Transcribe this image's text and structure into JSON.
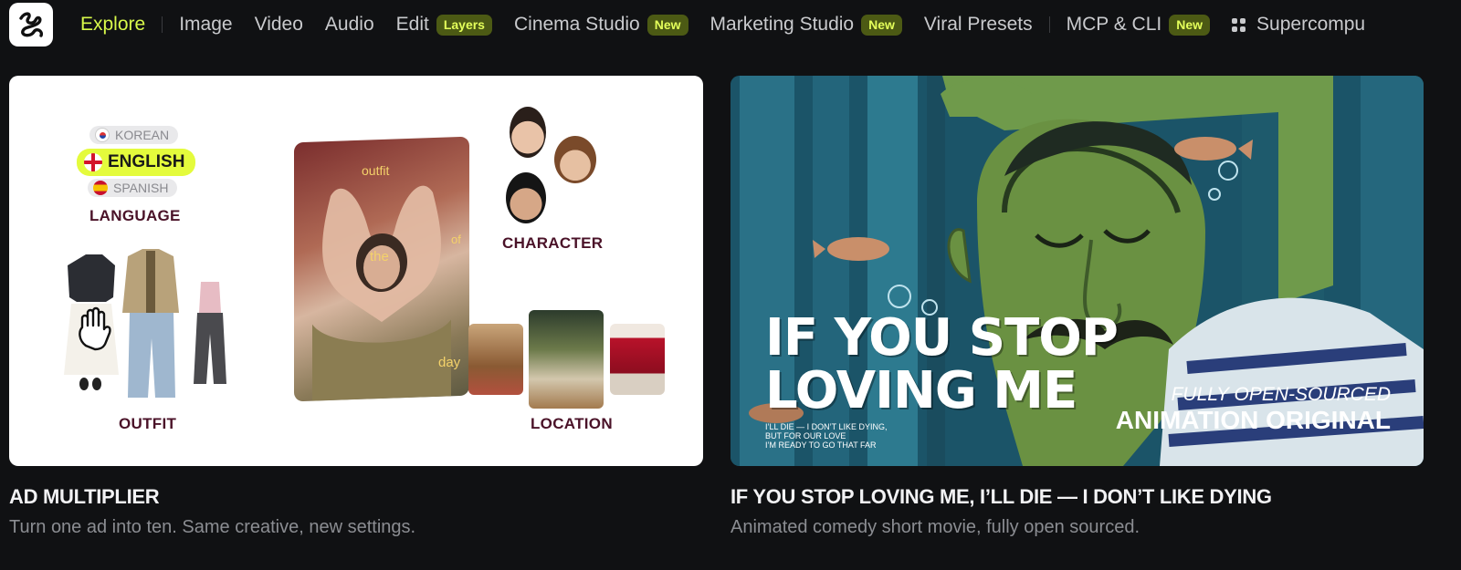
{
  "nav": {
    "items": [
      {
        "label": "Explore",
        "active": true
      },
      {
        "label": "Image"
      },
      {
        "label": "Video"
      },
      {
        "label": "Audio"
      },
      {
        "label": "Edit",
        "badge": "Layers"
      },
      {
        "label": "Cinema Studio",
        "badge": "New"
      },
      {
        "label": "Marketing Studio",
        "badge": "New"
      },
      {
        "label": "Viral Presets"
      },
      {
        "label": "MCP & CLI",
        "badge": "New"
      },
      {
        "label": "Supercompu"
      }
    ]
  },
  "cards": [
    {
      "title": "AD MULTIPLIER",
      "subtitle": "Turn one ad into ten. Same creative, new settings.",
      "image": {
        "languages": [
          "KOREAN",
          "ENGLISH",
          "SPANISH"
        ],
        "language_label": "LANGUAGE",
        "character_label": "CHARACTER",
        "outfit_label": "OUTFIT",
        "location_label": "LOCATION",
        "overlay_words": [
          "outfit",
          "of",
          "the",
          "day"
        ]
      }
    },
    {
      "title": "IF YOU STOP LOVING ME, I’LL DIE — I DON’T LIKE DYING",
      "subtitle": "Animated comedy short movie, fully open sourced.",
      "image": {
        "poster_line1": "IF YOU STOP",
        "poster_line2": "LOVING ME",
        "tagline_lines": [
          "I’LL DIE — I DON’T LIKE DYING,",
          "BUT FOR OUR LOVE",
          "I’M READY TO GO THAT FAR"
        ],
        "overlay_small": "FULLY OPEN-SOURCED",
        "overlay_big": "ANIMATION ORIGINAL"
      }
    }
  ],
  "colors": {
    "accent": "#d7f84a",
    "background": "#101113"
  }
}
